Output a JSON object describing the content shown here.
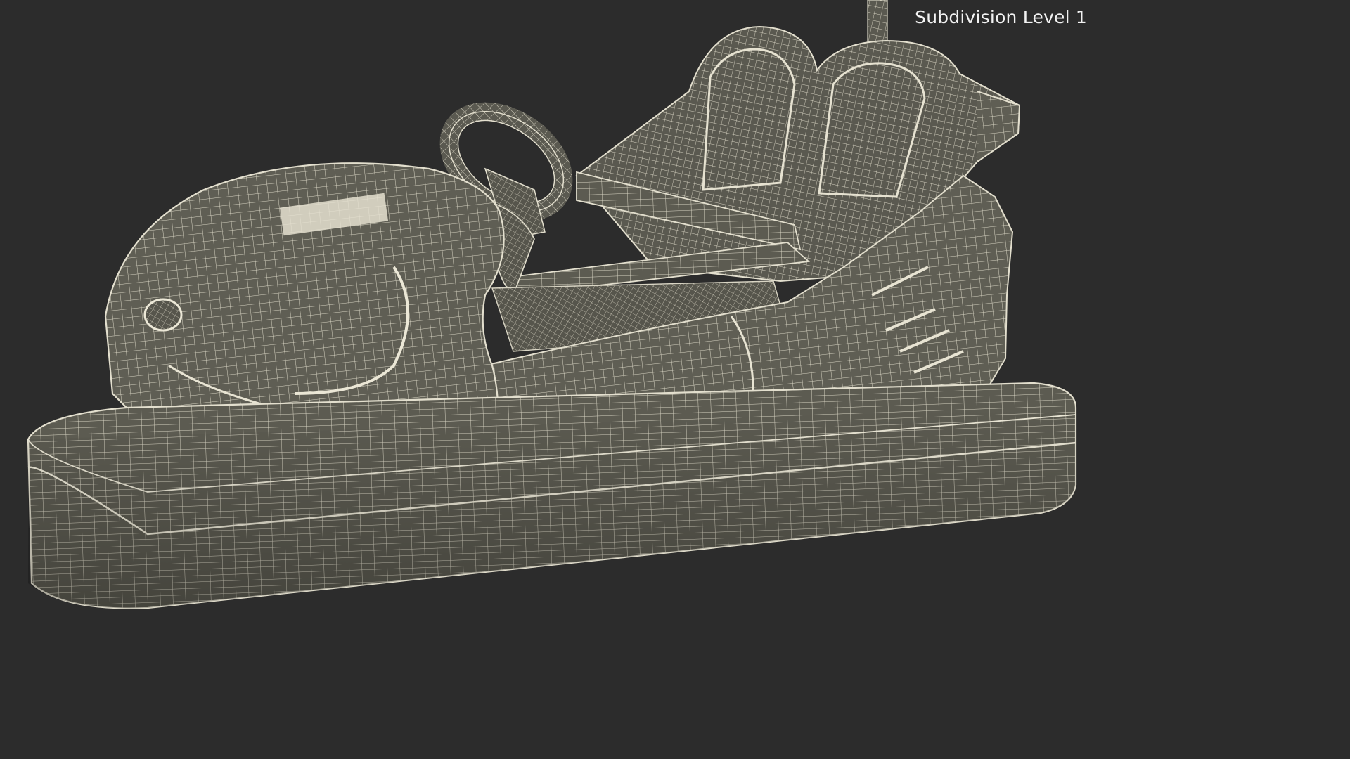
{
  "viewport": {
    "label": "Subdivision Level 1",
    "background_color": "#2c2c2c"
  },
  "model": {
    "subject": "bumper car wireframe render",
    "surface_color": "#5d5d52",
    "wire_color": "#ddd9c8"
  }
}
